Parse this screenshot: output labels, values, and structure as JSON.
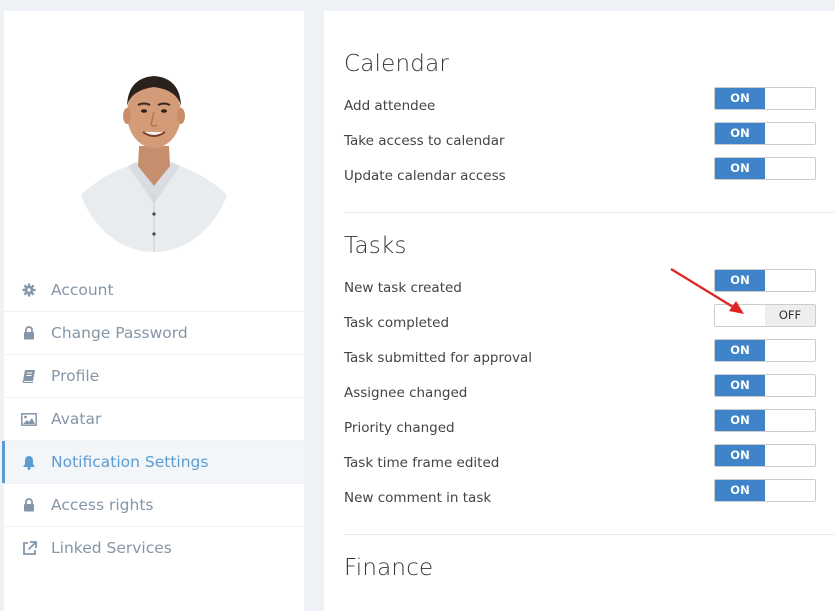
{
  "sidebar": {
    "avatar_alt": "User avatar",
    "items": [
      {
        "label": "Account",
        "icon": "gear-icon",
        "active": false
      },
      {
        "label": "Change Password",
        "icon": "lock-icon",
        "active": false
      },
      {
        "label": "Profile",
        "icon": "book-icon",
        "active": false
      },
      {
        "label": "Avatar",
        "icon": "image-icon",
        "active": false
      },
      {
        "label": "Notification Settings",
        "icon": "bell-icon",
        "active": true
      },
      {
        "label": "Access rights",
        "icon": "lock-icon",
        "active": false
      },
      {
        "label": "Linked Services",
        "icon": "external-link-icon",
        "active": false
      }
    ]
  },
  "sections": [
    {
      "title": "Calendar",
      "rows": [
        {
          "label": "Add attendee",
          "state": "ON"
        },
        {
          "label": "Take access to calendar",
          "state": "ON"
        },
        {
          "label": "Update calendar access",
          "state": "ON"
        }
      ]
    },
    {
      "title": "Tasks",
      "rows": [
        {
          "label": "New task created",
          "state": "ON"
        },
        {
          "label": "Task completed",
          "state": "OFF"
        },
        {
          "label": "Task submitted for approval",
          "state": "ON"
        },
        {
          "label": "Assignee changed",
          "state": "ON"
        },
        {
          "label": "Priority changed",
          "state": "ON"
        },
        {
          "label": "Task time frame edited",
          "state": "ON"
        },
        {
          "label": "New comment in task",
          "state": "ON"
        }
      ]
    },
    {
      "title": "Finance",
      "rows": []
    }
  ],
  "toggle_labels": {
    "on": "ON",
    "off": "OFF"
  },
  "colors": {
    "accent": "#3f84c9",
    "active_nav": "#5b9bd1",
    "annotation_arrow": "#e02424"
  }
}
